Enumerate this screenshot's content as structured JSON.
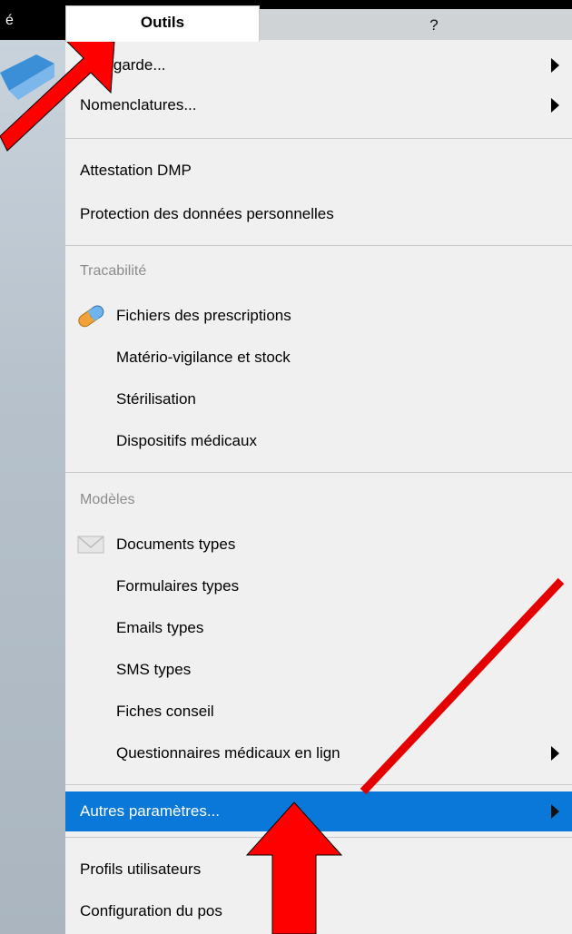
{
  "menubar": {
    "left_fragment": "é",
    "tab_outils": "Outils",
    "tab_help": "?"
  },
  "menu": {
    "items": [
      {
        "label": "auvegarde...",
        "submenu": true
      },
      {
        "label": "Nomenclatures...",
        "submenu": true
      },
      {
        "label": "Attestation DMP"
      },
      {
        "label": "Protection des données personnelles"
      },
      {
        "label": "Fichiers des prescriptions",
        "icon": "pill-icon"
      },
      {
        "label": "Matério-vigilance et stock"
      },
      {
        "label": "Stérilisation"
      },
      {
        "label": "Dispositifs médicaux"
      },
      {
        "label": "Documents types",
        "icon": "envelope-icon"
      },
      {
        "label": "Formulaires types"
      },
      {
        "label": "Emails types"
      },
      {
        "label": "SMS types"
      },
      {
        "label": "Fiches conseil"
      },
      {
        "label": "Questionnaires médicaux en lign",
        "submenu": true
      },
      {
        "label": "Autres paramètres...",
        "submenu": true,
        "selected": true
      },
      {
        "label": "Profils utilisateurs"
      },
      {
        "label": "Configuration du pos"
      }
    ],
    "headers": {
      "tracabilite": "Tracabilité",
      "modeles": "Modèles"
    }
  },
  "colors": {
    "selection": "#0a78d8",
    "annotation_red": "#ff0000"
  }
}
